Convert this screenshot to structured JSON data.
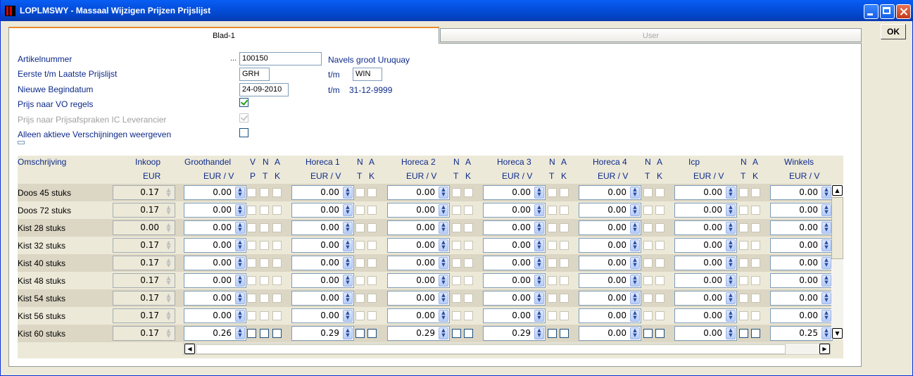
{
  "window": {
    "title": "LOPLMSWY - Massaal Wijzigen Prijzen Prijslijst"
  },
  "tabs": [
    {
      "label": "Blad-1"
    },
    {
      "label": "User"
    }
  ],
  "ok_label": "OK",
  "form": {
    "artikelnummer_label": "Artikelnummer",
    "artikelnummer_dots": "...",
    "artikelnummer_value": "100150",
    "artikel_omschrijving": "Navels groot Uruquay",
    "prijslijst_label": "Eerste t/m Laatste Prijslijst",
    "prijslijst_from": "GRH",
    "tm1": "t/m",
    "prijslijst_to": "WIN",
    "begindatum_label": "Nieuwe Begindatum",
    "begindatum_value": "24-09-2010",
    "tm2": "t/m",
    "einddatum_value": "31-12-9999",
    "vo_label": "Prijs naar VO regels",
    "vo_checked": true,
    "ic_label": "Prijs naar Prijsafspraken IC Leverancier",
    "ic_checked": true,
    "alleen_label": "Alleen aktieve Verschijningen weergeven",
    "alleen_checked": false
  },
  "grid": {
    "headers": {
      "omschrijving": "Omschrijving",
      "inkoop": "Inkoop",
      "inkoop_sub": "EUR",
      "groothandel": "Groothandel",
      "groothandel_sub": "EUR / V",
      "v": "V",
      "p": "P",
      "n": "N",
      "t": "T",
      "a": "A",
      "k": "K",
      "horeca1": "Horeca 1",
      "horeca2": "Horeca 2",
      "horeca3": "Horeca 3",
      "horeca4": "Horeca 4",
      "icp": "Icp",
      "winkels": "Winkels",
      "eur_v": "EUR / V"
    },
    "rows": [
      {
        "name": "Doos 45 stuks",
        "inkoop": "0.17",
        "gh": "0.00",
        "h1": "0.00",
        "h2": "0.00",
        "h3": "0.00",
        "h4": "0.00",
        "icp": "0.00",
        "wk": "0.00",
        "active": false
      },
      {
        "name": "Doos 72 stuks",
        "inkoop": "0.17",
        "gh": "0.00",
        "h1": "0.00",
        "h2": "0.00",
        "h3": "0.00",
        "h4": "0.00",
        "icp": "0.00",
        "wk": "0.00",
        "active": false
      },
      {
        "name": "Kist 28 stuks",
        "inkoop": "0.00",
        "gh": "0.00",
        "h1": "0.00",
        "h2": "0.00",
        "h3": "0.00",
        "h4": "0.00",
        "icp": "0.00",
        "wk": "0.00",
        "active": false
      },
      {
        "name": "Kist 32 stuks",
        "inkoop": "0.17",
        "gh": "0.00",
        "h1": "0.00",
        "h2": "0.00",
        "h3": "0.00",
        "h4": "0.00",
        "icp": "0.00",
        "wk": "0.00",
        "active": false
      },
      {
        "name": "Kist 40 stuks",
        "inkoop": "0.17",
        "gh": "0.00",
        "h1": "0.00",
        "h2": "0.00",
        "h3": "0.00",
        "h4": "0.00",
        "icp": "0.00",
        "wk": "0.00",
        "active": false
      },
      {
        "name": "Kist 48 stuks",
        "inkoop": "0.17",
        "gh": "0.00",
        "h1": "0.00",
        "h2": "0.00",
        "h3": "0.00",
        "h4": "0.00",
        "icp": "0.00",
        "wk": "0.00",
        "active": false
      },
      {
        "name": "Kist 54 stuks",
        "inkoop": "0.17",
        "gh": "0.00",
        "h1": "0.00",
        "h2": "0.00",
        "h3": "0.00",
        "h4": "0.00",
        "icp": "0.00",
        "wk": "0.00",
        "active": false
      },
      {
        "name": "Kist 56 stuks",
        "inkoop": "0.17",
        "gh": "0.00",
        "h1": "0.00",
        "h2": "0.00",
        "h3": "0.00",
        "h4": "0.00",
        "icp": "0.00",
        "wk": "0.00",
        "active": false
      },
      {
        "name": "Kist 60 stuks",
        "inkoop": "0.17",
        "gh": "0.26",
        "h1": "0.29",
        "h2": "0.29",
        "h3": "0.29",
        "h4": "0.00",
        "icp": "0.00",
        "wk": "0.25",
        "active": true
      }
    ]
  },
  "colors": {
    "titlebar": "#0553E4",
    "label_blue": "#0D2A8A",
    "tab_accent": "#E68B2C",
    "row_alt": "#DCD6C4"
  },
  "icons": {
    "app": "app-icon",
    "minimize": "minimize-icon",
    "maximize": "maximize-icon",
    "close": "close-icon"
  }
}
